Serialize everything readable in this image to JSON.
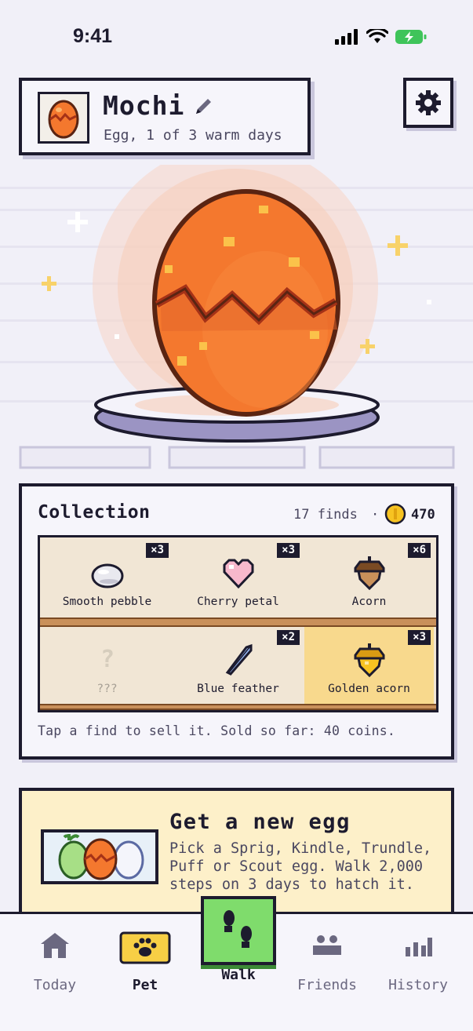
{
  "status_bar": {
    "time": "9:41"
  },
  "pet": {
    "name": "Mochi",
    "status": "Egg, 1 of 3 warm days",
    "avatar_icon": "orange-egg-icon"
  },
  "collection": {
    "title": "Collection",
    "finds": "17 finds",
    "separator": "·",
    "coins": "470",
    "items": [
      {
        "label": "Smooth pebble",
        "count": "×3",
        "icon": "pebble-icon"
      },
      {
        "label": "Cherry petal",
        "count": "×3",
        "icon": "heart-petal-icon"
      },
      {
        "label": "Acorn",
        "count": "×6",
        "icon": "acorn-icon"
      },
      {
        "label": "???",
        "count": "",
        "icon": "unknown-icon",
        "glyph": "?"
      },
      {
        "label": "Blue feather",
        "count": "×2",
        "icon": "feather-icon"
      },
      {
        "label": "Golden acorn",
        "count": "×3",
        "icon": "golden-acorn-icon"
      }
    ],
    "footer": "Tap a find to sell it. Sold so far: 40 coins."
  },
  "new_egg": {
    "title": "Get a new egg",
    "body": "Pick a Sprig, Kindle, Trundle, Puff or Scout egg. Walk 2,000 steps on 3 days to hatch it."
  },
  "tabs": [
    {
      "label": "Today",
      "icon": "house-icon"
    },
    {
      "label": "Pet",
      "icon": "paw-icon"
    },
    {
      "label": "Walk",
      "icon": "footprints-icon"
    },
    {
      "label": "Friends",
      "icon": "friends-icon"
    },
    {
      "label": "History",
      "icon": "bar-chart-icon"
    }
  ],
  "colors": {
    "ink": "#1d1b2e",
    "egg_orange": "#f4782e",
    "walk_green": "#7fdc6c",
    "pet_yellow": "#f7cf45",
    "shelf": "#f1e6d5",
    "card_cream": "#fdf0c9"
  }
}
